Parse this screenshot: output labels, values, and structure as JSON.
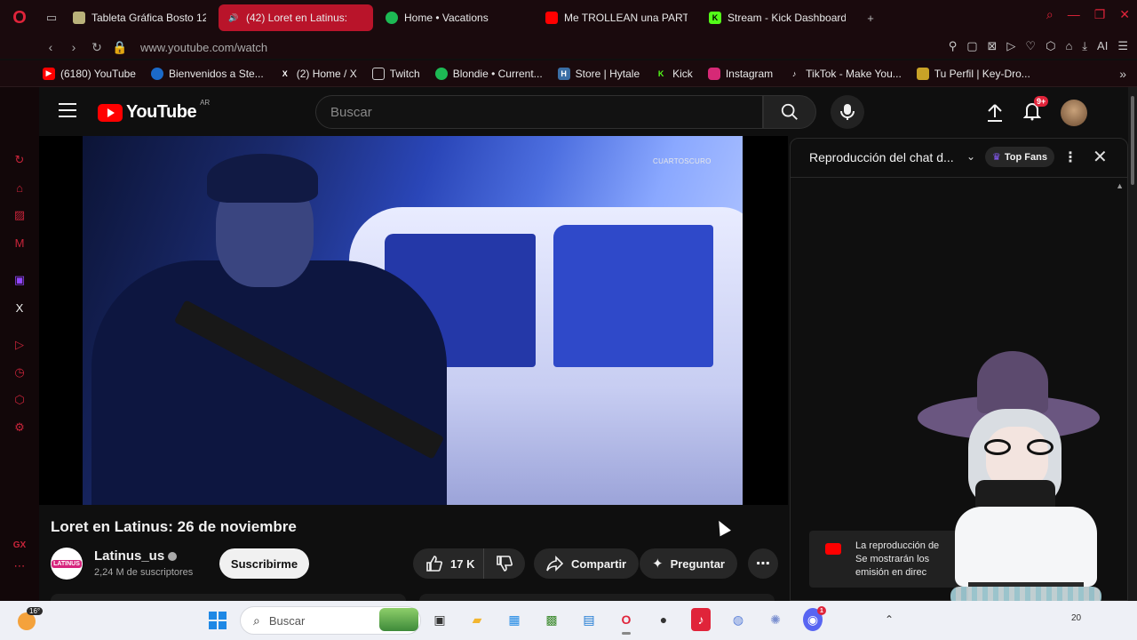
{
  "browser": {
    "tabs": [
      {
        "label": "Tableta Gráfica Bosto 12",
        "icon_color": "#b9b27a",
        "active": false
      },
      {
        "label": "(42) Loret en Latinus:",
        "icon_color": "#ffffff",
        "active": true
      },
      {
        "label": "Home • Vacations",
        "icon_color": "#1db954",
        "active": false
      },
      {
        "label": "Me TROLLEAN una PARTI",
        "icon_color": "#ff0000",
        "active": false
      },
      {
        "label": "Stream - Kick Dashboard",
        "icon_color": "#53fc18",
        "active": false
      }
    ],
    "new_tab": "+",
    "url": "www.youtube.com/watch",
    "ai_label": "AI",
    "bookmarks": [
      {
        "label": "(6180) YouTube",
        "icon_color": "#ff0000"
      },
      {
        "label": "Bienvenidos a Ste...",
        "icon_color": "#1b6ac9"
      },
      {
        "label": "(2) Home / X",
        "icon_color": "#222222"
      },
      {
        "label": "Twitch",
        "icon_color": "#9146ff"
      },
      {
        "label": "Blondie • Current...",
        "icon_color": "#1db954"
      },
      {
        "label": "Store | Hytale",
        "icon_color": "#3a6ea5"
      },
      {
        "label": "Kick",
        "icon_color": "#53fc18"
      },
      {
        "label": "Instagram",
        "icon_color": "#d62976"
      },
      {
        "label": "TikTok - Make You...",
        "icon_color": "#222222"
      },
      {
        "label": "Tu Perfil | Key-Dro...",
        "icon_color": "#c9a227"
      }
    ]
  },
  "youtube": {
    "logo_text": "YouTube",
    "country_code": "AR",
    "search_placeholder": "Buscar",
    "notification_count": "9+",
    "watermark": "CUARTOSCURO",
    "video_title": "Loret en Latinus: 26 de noviembre",
    "channel": {
      "name": "Latinus_us",
      "avatar_text": "LATINUS",
      "subscribers": "2,24 M de suscriptores"
    },
    "subscribe_label": "Suscribirme",
    "likes": "17 K",
    "share_label": "Compartir",
    "ask_label": "Preguntar",
    "chat": {
      "title": "Reproducción del chat d...",
      "top_fans_label": "Top Fans",
      "notice_lines": [
        "La reproducción de",
        "Se mostrarán los",
        "emisión en direc"
      ]
    }
  },
  "taskbar": {
    "temperature": "16°",
    "search_placeholder": "Buscar",
    "notification_badge": "1",
    "clock": "20"
  },
  "colors": {
    "browser_bg": "#1a0a0d",
    "opera_red": "#e0243a",
    "active_tab": "#b9142a",
    "youtube_bg": "#0f0f0f",
    "youtube_red": "#ff0000"
  }
}
